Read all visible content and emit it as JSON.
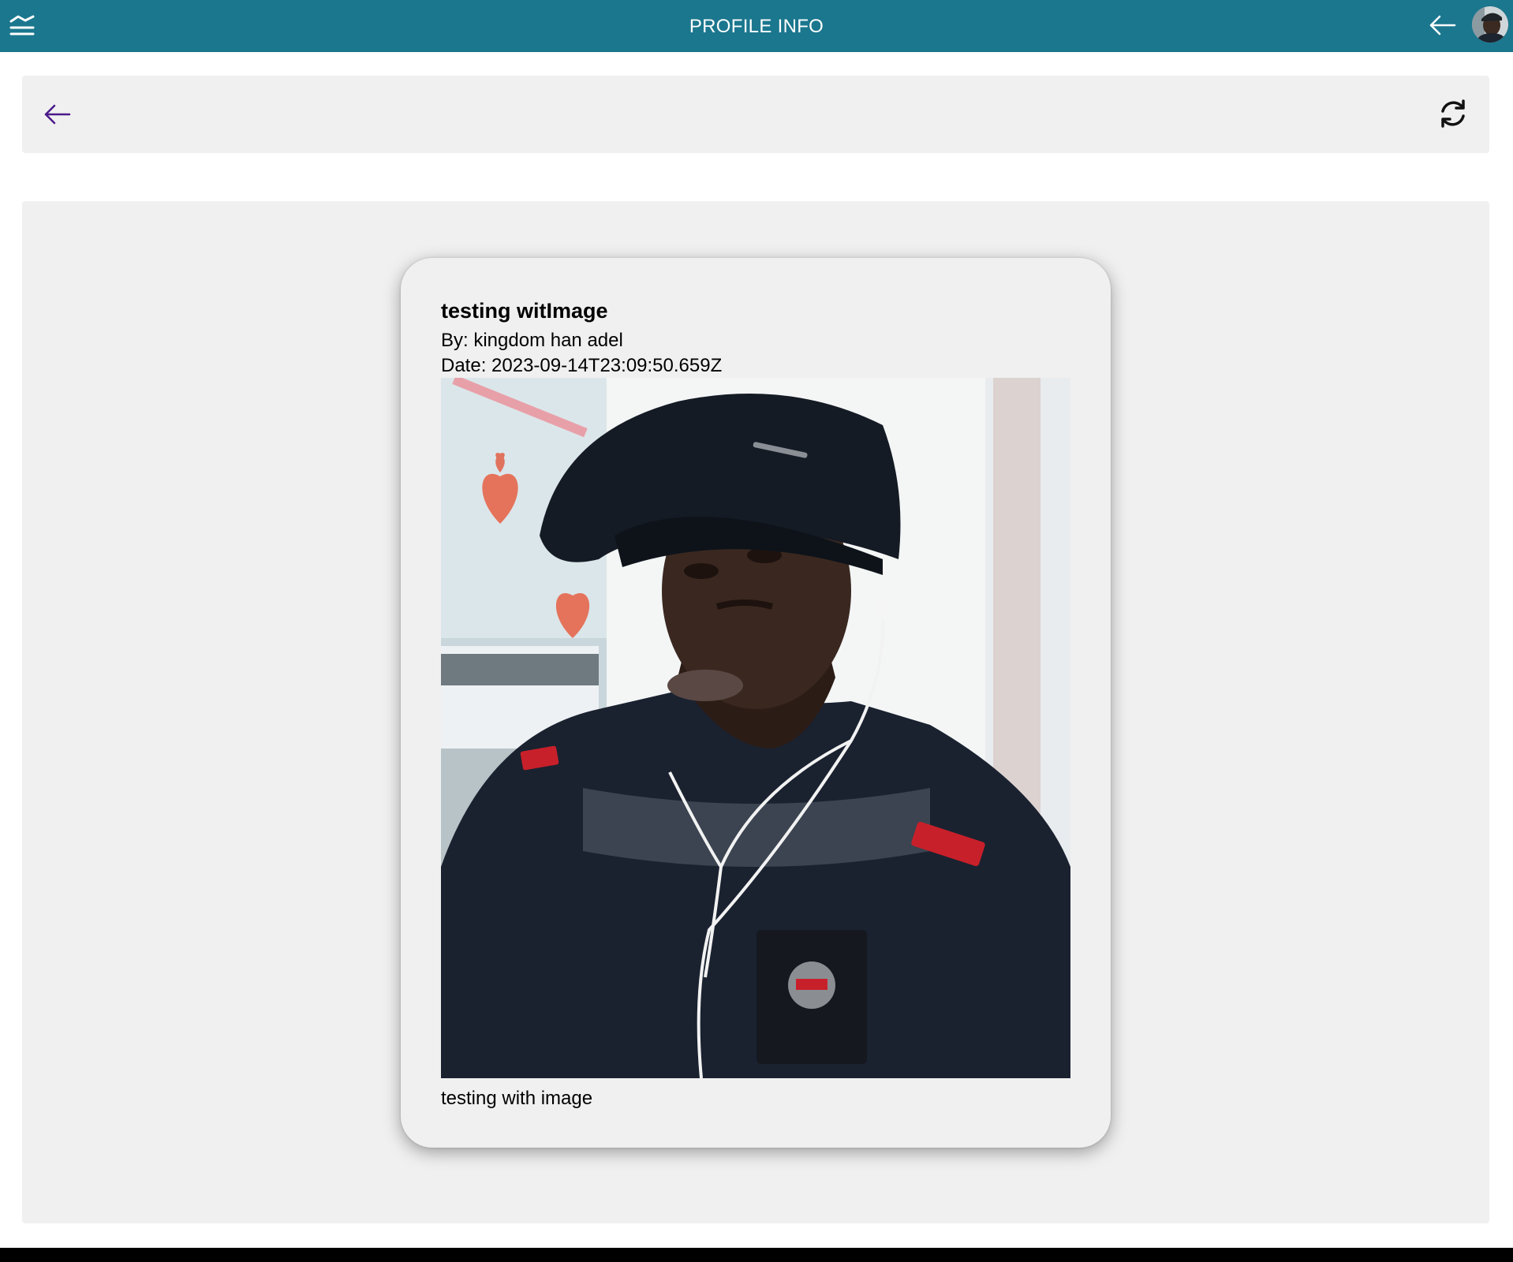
{
  "header": {
    "title": "PROFILE INFO",
    "menu_icon": "menu-waves-icon",
    "back_icon": "arrow-left-icon",
    "avatar_icon": "user-avatar",
    "background_color": "#1b778e"
  },
  "toolbar": {
    "back_icon": "arrow-left-icon",
    "refresh_icon": "refresh-icon",
    "back_icon_color": "#4b1a8a"
  },
  "post": {
    "title": "testing witImage",
    "author": "By: kingdom han adel",
    "date": "Date: 2023-09-14T23:09:50.659Z",
    "image_icon": "photo-selfie",
    "body": "testing with image"
  }
}
